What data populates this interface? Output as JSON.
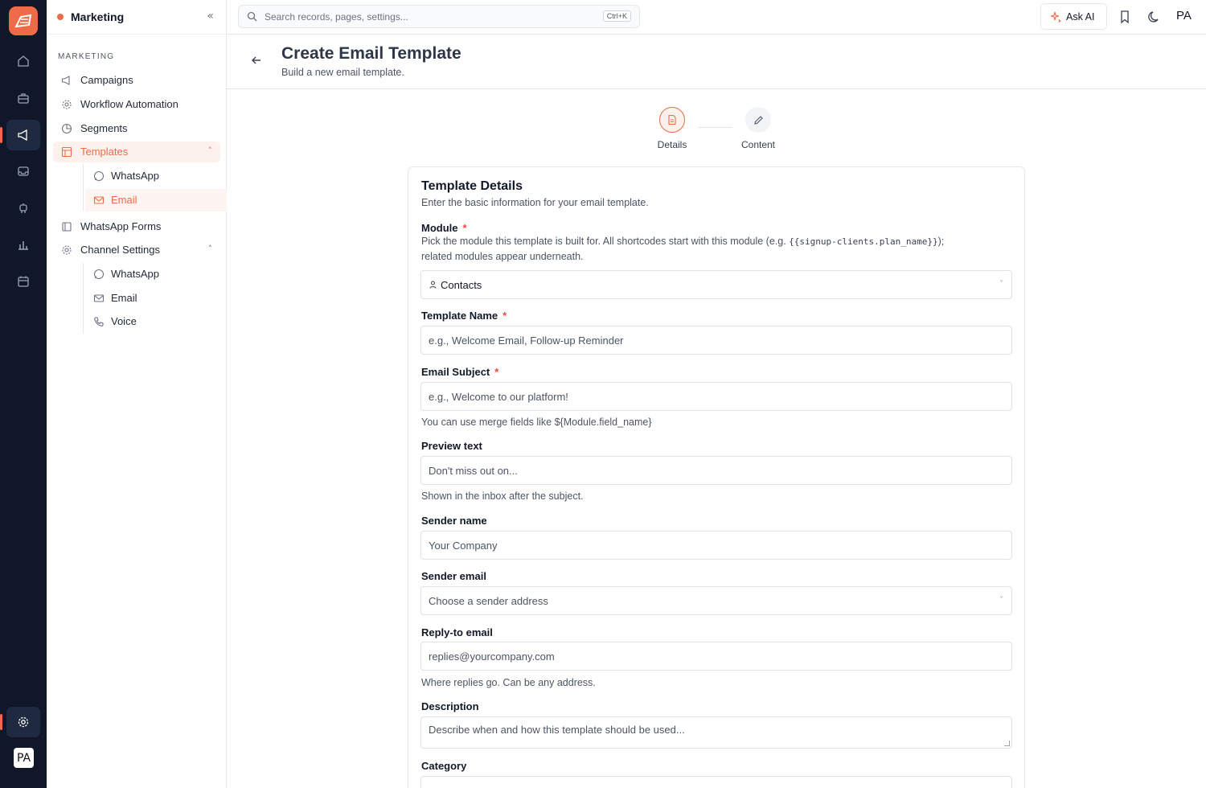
{
  "rail": {
    "icons": [
      "home-icon",
      "briefcase-icon",
      "megaphone-icon",
      "inbox-icon",
      "robot-icon",
      "bar-chart-icon",
      "calendar-icon",
      "settings-icon"
    ],
    "avatar": "PA",
    "accent": "#ef6a48",
    "bg": "#0f1729"
  },
  "sidebar": {
    "title": "Marketing",
    "section": "MARKETING",
    "items": [
      {
        "label": "Campaigns",
        "icon": "megaphone-icon"
      },
      {
        "label": "Workflow Automation",
        "icon": "workflow-icon"
      },
      {
        "label": "Segments",
        "icon": "pie-chart-icon"
      },
      {
        "label": "Templates",
        "icon": "template-icon",
        "expanded": true,
        "active": true,
        "children": [
          {
            "label": "WhatsApp",
            "icon": "whatsapp-icon"
          },
          {
            "label": "Email",
            "icon": "mail-icon",
            "active": true
          }
        ]
      },
      {
        "label": "WhatsApp Forms",
        "icon": "form-icon"
      },
      {
        "label": "Channel Settings",
        "icon": "settings-icon",
        "expanded": true,
        "children": [
          {
            "label": "WhatsApp",
            "icon": "whatsapp-icon"
          },
          {
            "label": "Email",
            "icon": "mail-icon"
          },
          {
            "label": "Voice",
            "icon": "phone-icon"
          }
        ]
      }
    ]
  },
  "topbar": {
    "search_placeholder": "Search records, pages, settings...",
    "shortcut": "Ctrl+K",
    "ask_ai": "Ask AI",
    "avatar": "PA"
  },
  "page": {
    "title": "Create Email Template",
    "subtitle": "Build a new email template."
  },
  "stepper": {
    "steps": [
      {
        "label": "Details",
        "active": true
      },
      {
        "label": "Content",
        "active": false
      }
    ]
  },
  "form": {
    "title": "Template Details",
    "subtitle": "Enter the basic information for your email template.",
    "module": {
      "label": "Module",
      "help_prefix": "Pick the module this template is built for. All shortcodes start with this module (e.g. ",
      "help_code": "{{signup-clients.plan_name}}",
      "help_suffix": ");",
      "help_line2": "related modules appear underneath.",
      "value": "Contacts"
    },
    "template_name": {
      "label": "Template Name",
      "placeholder": "e.g., Welcome Email, Follow-up Reminder"
    },
    "email_subject": {
      "label": "Email Subject",
      "placeholder": "e.g., Welcome to our platform!",
      "help": "You can use merge fields like ${Module.field_name}"
    },
    "preview_text": {
      "label": "Preview text",
      "placeholder": "Don't miss out on...",
      "help": "Shown in the inbox after the subject."
    },
    "sender_name": {
      "label": "Sender name",
      "placeholder": "Your Company"
    },
    "sender_email": {
      "label": "Sender email",
      "placeholder": "Choose a sender address"
    },
    "reply_to": {
      "label": "Reply-to email",
      "placeholder": "replies@yourcompany.com",
      "help": "Where replies go. Can be any address."
    },
    "description": {
      "label": "Description",
      "placeholder": "Describe when and how this template should be used..."
    },
    "category": {
      "label": "Category"
    }
  }
}
